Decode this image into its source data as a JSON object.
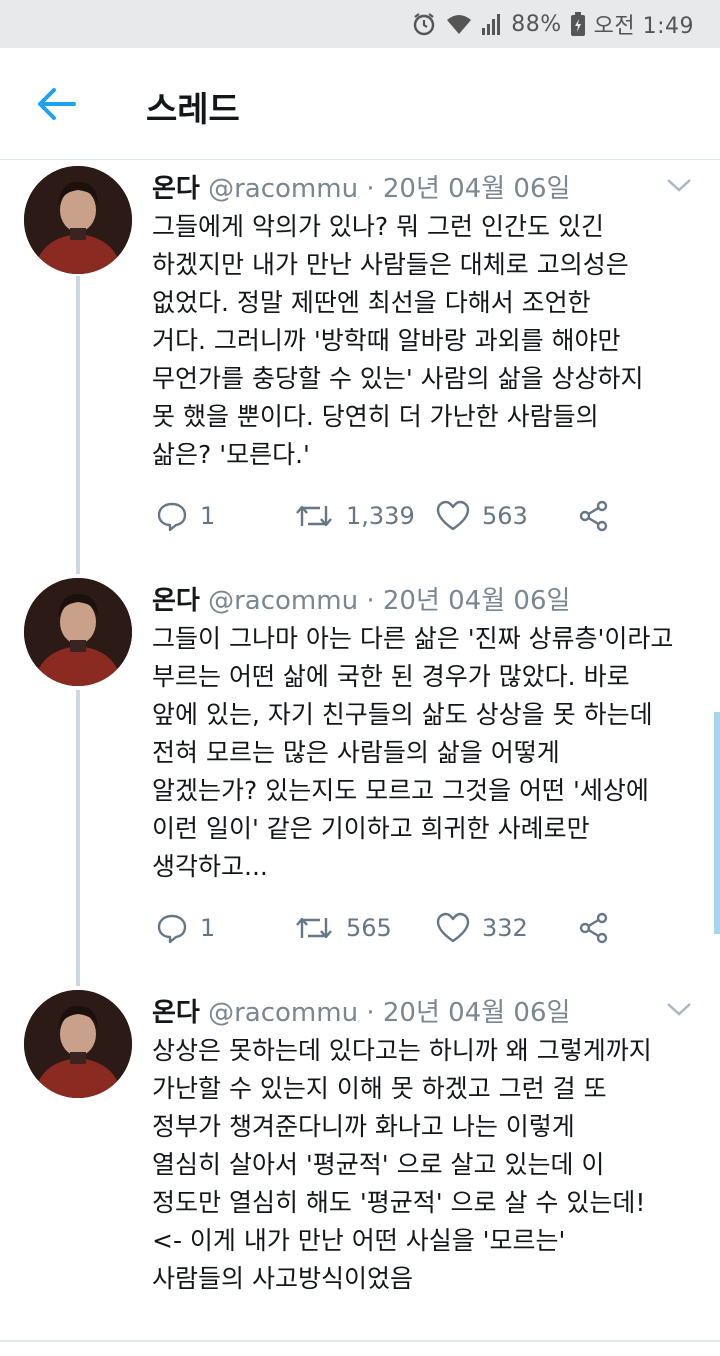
{
  "status_bar": {
    "battery_percent": "88%",
    "time": "오전 1:49",
    "icons": [
      "alarm-icon",
      "wifi-icon",
      "signal-icon",
      "battery-icon"
    ]
  },
  "header": {
    "back_icon": "back-arrow-icon",
    "title": "스레드"
  },
  "accent_color": "#1da1f2",
  "tweets": [
    {
      "name": "온다",
      "handle": "@racommu",
      "date": " · 20년 04월 06일",
      "lines": [
        "그들에게 악의가 있나? 뭐 그런 인간도 있긴",
        "하겠지만 내가 만난 사람들은 대체로 고의성은",
        "없었다. 정말 제딴엔 최선을 다해서 조언한",
        "거다. 그러니까 '방학때 알바랑 과외를 해야만",
        "무언가를 충당할 수 있는' 사람의 삶을 상상하지",
        "못 했을 뿐이다. 당연히 더 가난한 사람들의",
        "삶은? '모른다.'"
      ],
      "replies": "1",
      "retweets": "1,339",
      "likes": "563"
    },
    {
      "name": "온다",
      "handle": "@racommu",
      "date": " · 20년 04월 06일",
      "lines": [
        "그들이 그나마 아는 다른 삶은 '진짜 상류층'이라고",
        "부르는 어떤 삶에 국한 된 경우가 많았다. 바로",
        "앞에 있는, 자기 친구들의 삶도 상상을 못 하는데",
        "전혀 모르는 많은 사람들의 삶을 어떻게",
        "알겠는가? 있는지도 모르고 그것을 어떤 '세상에",
        "이런 일이' 같은 기이하고 희귀한 사례로만",
        "생각하고..."
      ],
      "replies": "1",
      "retweets": "565",
      "likes": "332"
    },
    {
      "name": "온다",
      "handle": "@racommu",
      "date": " · 20년 04월 06일",
      "lines": [
        "상상은 못하는데 있다고는 하니까 왜 그렇게까지",
        "가난할 수 있는지 이해 못 하겠고 그런 걸 또",
        "정부가 챙겨준다니까 화나고 나는 이렇게",
        "열심히 살아서 '평균적' 으로 살고 있는데 이",
        "정도만 열심히 해도 '평균적' 으로 살 수 있는데!",
        "<- 이게 내가 만난 어떤 사실을 '모르는'",
        "사람들의 사고방식이었음"
      ]
    }
  ]
}
